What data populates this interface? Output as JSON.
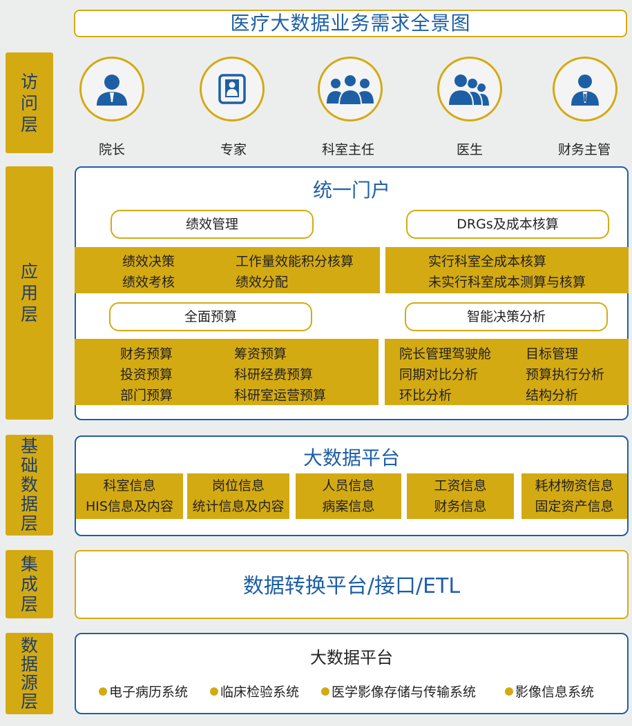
{
  "title": "医疗大数据业务需求全景图",
  "layers": {
    "access": [
      "访",
      "问",
      "层"
    ],
    "application": [
      "应",
      "用",
      "层"
    ],
    "foundation": [
      "基",
      "础",
      "数",
      "据",
      "层"
    ],
    "integration": [
      "集",
      "成",
      "层"
    ],
    "source": [
      "数",
      "据",
      "源",
      "层"
    ]
  },
  "roles": [
    "院长",
    "专家",
    "科室主任",
    "医生",
    "财务主管"
  ],
  "portal": {
    "title": "统一门户",
    "performance": {
      "label": "绩效管理",
      "col1": [
        "绩效决策",
        "绩效考核"
      ],
      "col2": [
        "工作量效能积分核算",
        "绩效分配"
      ]
    },
    "drgs": {
      "label": "DRGs及成本核算",
      "items": [
        "实行科室全成本核算",
        "未实行科室成本测算与核算"
      ]
    },
    "budget": {
      "label": "全面预算",
      "col1": [
        "财务预算",
        "投资预算",
        "部门预算"
      ],
      "col2": [
        "筹资预算",
        "科研经费预算",
        "科研室运营预算"
      ]
    },
    "decision": {
      "label": "智能决策分析",
      "col1": [
        "院长管理驾驶舱",
        "同期对比分析",
        "环比分析"
      ],
      "col2": [
        "目标管理",
        "预算执行分析",
        "结构分析"
      ]
    }
  },
  "foundation_platform": {
    "title": "大数据平台",
    "cells": [
      [
        "科室信息",
        "HIS信息及内容"
      ],
      [
        "岗位信息",
        "统计信息及内容"
      ],
      [
        "人员信息",
        "病案信息"
      ],
      [
        "工资信息",
        "财务信息"
      ],
      [
        "耗材物资信息",
        "固定资产信息"
      ]
    ]
  },
  "integration_text": "数据转换平台/接口/ETL",
  "source_platform": {
    "title": "大数据平台",
    "items": [
      "电子病历系统",
      "临床检验系统",
      "医学影像存储与传输系统",
      "影像信息系统"
    ]
  }
}
